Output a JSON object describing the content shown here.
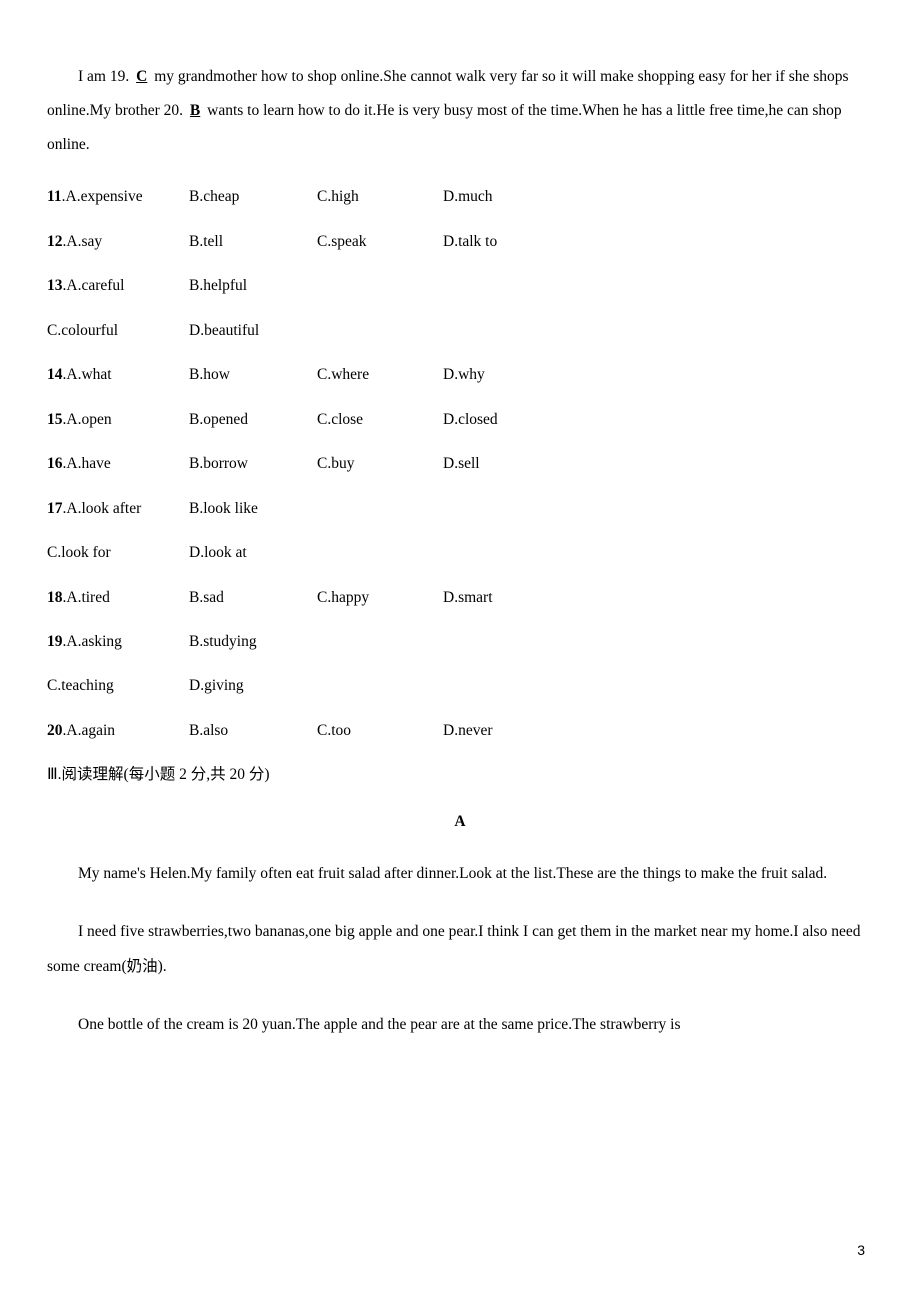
{
  "intro_paragraph": {
    "seg1": "I am 19.",
    "ans19": "C",
    "seg2": "my grandmother how to shop online.She cannot walk very far so it will make shopping easy for her if she shops online.My brother 20.",
    "ans20": "B",
    "seg3": "wants to learn how to do it.He is very busy most of the time.When he has a little free time,he can shop online."
  },
  "questions": [
    {
      "num": "11",
      "opts": [
        "A.expensive",
        "B.cheap",
        "C.high",
        "D.much"
      ]
    },
    {
      "num": "12",
      "opts": [
        "A.say",
        "B.tell",
        "C.speak",
        "D.talk to"
      ]
    },
    {
      "num": "13",
      "opts": [
        "A.careful",
        "B.helpful"
      ],
      "opts2": [
        "C.colourful",
        "D.beautiful"
      ]
    },
    {
      "num": "14",
      "opts": [
        "A.what",
        "B.how",
        "C.where",
        "D.why"
      ]
    },
    {
      "num": "15",
      "opts": [
        "A.open",
        "B.opened",
        "C.close",
        "D.closed"
      ]
    },
    {
      "num": "16",
      "opts": [
        "A.have",
        "B.borrow",
        "C.buy",
        "D.sell"
      ]
    },
    {
      "num": "17",
      "opts": [
        "A.look after",
        "B.look like"
      ],
      "opts2": [
        "C.look for",
        "D.look at"
      ]
    },
    {
      "num": "18",
      "opts": [
        "A.tired",
        "B.sad",
        "C.happy",
        "D.smart"
      ]
    },
    {
      "num": "19",
      "opts": [
        "A.asking",
        "B.studying"
      ],
      "opts2": [
        "C.teaching",
        "D.giving"
      ]
    },
    {
      "num": "20",
      "opts": [
        "A.again",
        "B.also",
        "C.too",
        "D.never"
      ]
    }
  ],
  "section3_title": "Ⅲ.阅读理解(每小题 2 分,共 20 分)",
  "passage_label": "A",
  "passage_paras": [
    "My name's Helen.My family often eat fruit salad after dinner.Look at the list.These are the things to make the fruit salad.",
    "I need five strawberries,two bananas,one big apple and one pear.I think I can get them in the market near my home.I also need some cream(奶油).",
    "One bottle of the cream is 20 yuan.The apple and the pear are at the same price.The strawberry is"
  ],
  "page_number": "3"
}
